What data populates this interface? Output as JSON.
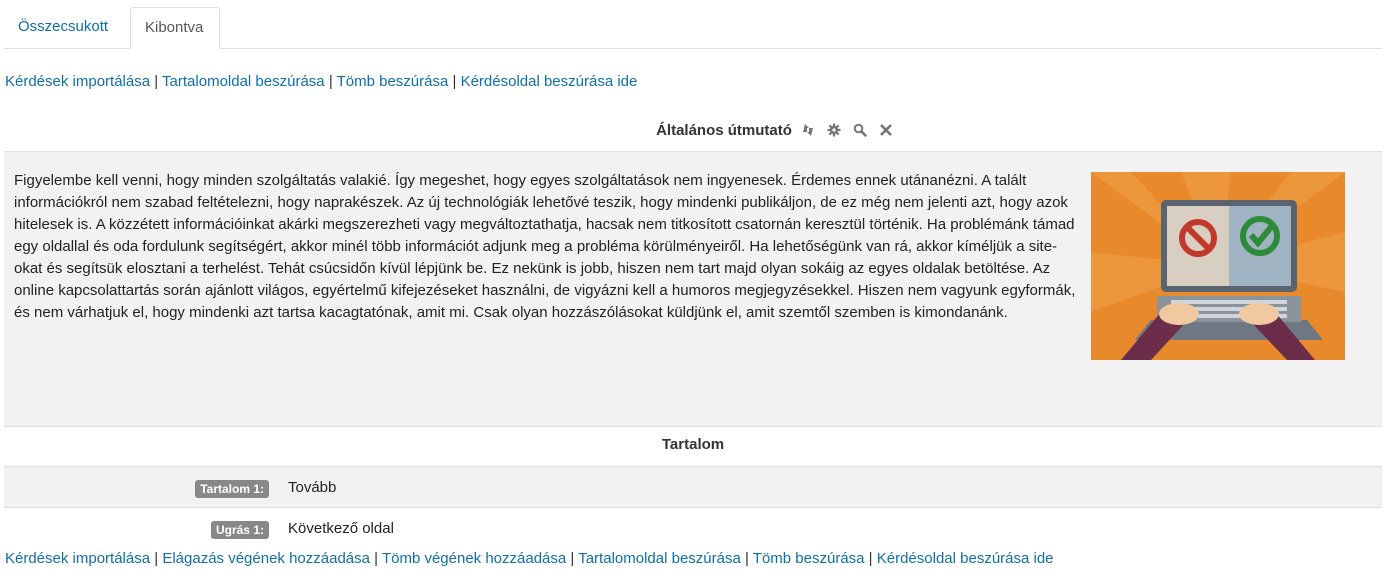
{
  "tabs": [
    {
      "label": "Összecsukott"
    },
    {
      "label": "Kibontva"
    }
  ],
  "top_links": [
    "Kérdések importálása",
    "Tartalomoldal beszúrása",
    "Tömb beszúrása",
    "Kérdésoldal beszúrása ide"
  ],
  "page": {
    "title": "Általános útmutató",
    "icons": [
      "move-icon",
      "gear-icon",
      "search-icon",
      "close-icon"
    ],
    "body": "Figyelembe kell venni, hogy minden szolgáltatás valakié. Így megeshet, hogy egyes szolgáltatások nem ingyenesek. Érdemes ennek utánanézni. A talált információkról nem szabad feltételezni, hogy naprakészek. Az új technológiák lehetővé teszik, hogy mindenki publikáljon, de ez még nem jelenti azt, hogy azok hitelesek is. A közzétett információinkat akárki megszerezheti vagy megváltoztathatja, hacsak nem titkosított csatornán keresztül történik. Ha problémánk támad egy oldallal és oda fordulunk segítségért, akkor minél több információt adjunk meg a probléma körülményeiről. Ha lehetőségünk van rá, akkor kíméljük a site-okat és segítsük elosztani a terhelést. Tehát csúcsidőn kívül lépjünk be. Ez nekünk is jobb, hiszen nem tart majd olyan sokáig az egyes oldalak betöltése. Az online kapcsolattartás során ajánlott világos, egyértelmű kifejezéseket használni, de vigyázni kell a humoros megjegyzésekkel. Hiszen nem vagyunk egyformák, és nem várhatjuk el, hogy mindenki azt tartsa kacagtatónak, amit mi. Csak olyan hozzászólásokat küldjünk el, amit szemtől szemben is kimondanánk."
  },
  "content_section": {
    "heading": "Tartalom",
    "rows": [
      {
        "label": "Tartalom 1:",
        "value": "Tovább"
      },
      {
        "label": "Ugrás 1:",
        "value": "Következő oldal"
      }
    ]
  },
  "bottom_links": [
    "Kérdések importálása",
    "Elágazás végének hozzáadása",
    "Tömb végének hozzáadása",
    "Tartalomoldal beszúrása",
    "Tömb beszúrása",
    "Kérdésoldal beszúrása ide"
  ],
  "colors": {
    "link": "#0f6fa8",
    "panel_bg": "#f2f2f2",
    "badge_bg": "#888888",
    "illustration_orange": "#e8892c"
  }
}
